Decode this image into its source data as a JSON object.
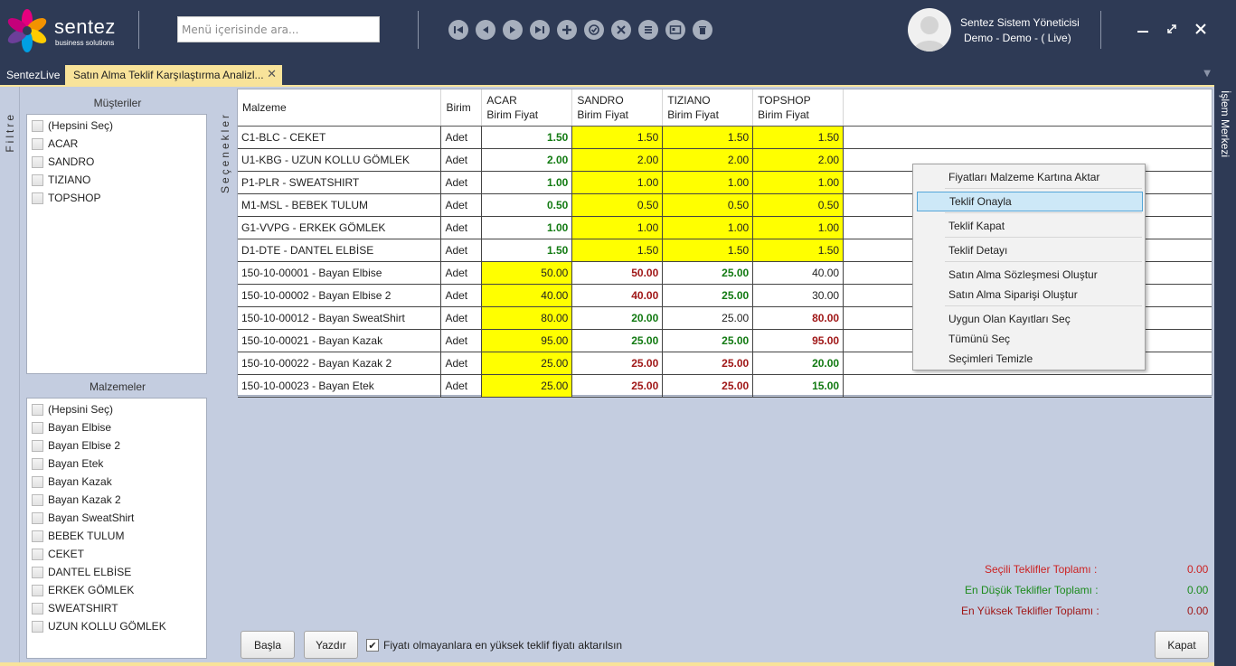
{
  "header": {
    "logo_text": "sentez",
    "logo_sub": "business solutions",
    "search_placeholder": "Menü içerisinde ara...",
    "nav_icons": [
      "first-icon",
      "prev-icon",
      "next-icon",
      "last-icon",
      "add-icon",
      "confirm-icon",
      "cancel-icon",
      "list-icon",
      "card-icon",
      "delete-icon"
    ],
    "user_name": "Sentez Sistem Yöneticisi",
    "user_context": "Demo - Demo - ( Live)"
  },
  "tabs": {
    "home": "SentezLive",
    "active": "Satın Alma Teklif Karşılaştırma Analizl...",
    "close": "✕"
  },
  "sidebar": {
    "filter_label": "Filtre",
    "options_label": "Seçenekler",
    "right_label": "İşlem Merkezi",
    "customers_title": "Müşteriler",
    "customers": [
      "(Hepsini Seç)",
      "ACAR",
      "SANDRO",
      "TIZIANO",
      "TOPSHOP"
    ],
    "materials_title": "Malzemeler",
    "materials": [
      "(Hepsini Seç)",
      "Bayan Elbise",
      "Bayan Elbise 2",
      "Bayan Etek",
      "Bayan Kazak",
      "Bayan Kazak 2",
      "Bayan SweatShirt",
      "BEBEK TULUM",
      "CEKET",
      "DANTEL ELBİSE",
      "ERKEK GÖMLEK",
      "SWEATSHIRT",
      "UZUN KOLLU GÖMLEK"
    ]
  },
  "grid": {
    "col_material": "Malzeme",
    "col_unit": "Birim",
    "suppliers": [
      {
        "name": "ACAR",
        "sub": "Birim Fiyat"
      },
      {
        "name": "SANDRO",
        "sub": "Birim Fiyat"
      },
      {
        "name": "TIZIANO",
        "sub": "Birim Fiyat"
      },
      {
        "name": "TOPSHOP",
        "sub": "Birim Fiyat"
      }
    ],
    "rows": [
      {
        "material": "C1-BLC - CEKET",
        "unit": "Adet",
        "cells": [
          {
            "v": "1.50",
            "s": "g"
          },
          {
            "v": "1.50",
            "s": "y"
          },
          {
            "v": "1.50",
            "s": "y"
          },
          {
            "v": "1.50",
            "s": "y"
          }
        ]
      },
      {
        "material": "U1-KBG - UZUN KOLLU GÖMLEK",
        "unit": "Adet",
        "cells": [
          {
            "v": "2.00",
            "s": "g"
          },
          {
            "v": "2.00",
            "s": "y"
          },
          {
            "v": "2.00",
            "s": "y"
          },
          {
            "v": "2.00",
            "s": "y"
          }
        ]
      },
      {
        "material": "P1-PLR - SWEATSHIRT",
        "unit": "Adet",
        "cells": [
          {
            "v": "1.00",
            "s": "g"
          },
          {
            "v": "1.00",
            "s": "y"
          },
          {
            "v": "1.00",
            "s": "y"
          },
          {
            "v": "1.00",
            "s": "y"
          }
        ]
      },
      {
        "material": "M1-MSL - BEBEK TULUM",
        "unit": "Adet",
        "cells": [
          {
            "v": "0.50",
            "s": "g"
          },
          {
            "v": "0.50",
            "s": "y"
          },
          {
            "v": "0.50",
            "s": "y"
          },
          {
            "v": "0.50",
            "s": "y"
          }
        ]
      },
      {
        "material": "G1-VVPG - ERKEK GÖMLEK",
        "unit": "Adet",
        "cells": [
          {
            "v": "1.00",
            "s": "g"
          },
          {
            "v": "1.00",
            "s": "y"
          },
          {
            "v": "1.00",
            "s": "y"
          },
          {
            "v": "1.00",
            "s": "y"
          }
        ]
      },
      {
        "material": "D1-DTE - DANTEL ELBİSE",
        "unit": "Adet",
        "cells": [
          {
            "v": "1.50",
            "s": "g"
          },
          {
            "v": "1.50",
            "s": "y"
          },
          {
            "v": "1.50",
            "s": "y"
          },
          {
            "v": "1.50",
            "s": "y"
          }
        ]
      },
      {
        "material": "150-10-00001 - Bayan Elbise",
        "unit": "Adet",
        "cells": [
          {
            "v": "50.00",
            "s": "y"
          },
          {
            "v": "50.00",
            "s": "r"
          },
          {
            "v": "25.00",
            "s": "g"
          },
          {
            "v": "40.00",
            "s": "n"
          }
        ]
      },
      {
        "material": "150-10-00002 - Bayan Elbise 2",
        "unit": "Adet",
        "cells": [
          {
            "v": "40.00",
            "s": "y"
          },
          {
            "v": "40.00",
            "s": "r"
          },
          {
            "v": "25.00",
            "s": "g"
          },
          {
            "v": "30.00",
            "s": "n"
          }
        ]
      },
      {
        "material": "150-10-00012 - Bayan SweatShirt",
        "unit": "Adet",
        "cells": [
          {
            "v": "80.00",
            "s": "y"
          },
          {
            "v": "20.00",
            "s": "g"
          },
          {
            "v": "25.00",
            "s": "n"
          },
          {
            "v": "80.00",
            "s": "r"
          }
        ]
      },
      {
        "material": "150-10-00021 - Bayan Kazak",
        "unit": "Adet",
        "cells": [
          {
            "v": "95.00",
            "s": "y"
          },
          {
            "v": "25.00",
            "s": "g"
          },
          {
            "v": "25.00",
            "s": "g"
          },
          {
            "v": "95.00",
            "s": "r"
          }
        ]
      },
      {
        "material": "150-10-00022 - Bayan Kazak 2",
        "unit": "Adet",
        "cells": [
          {
            "v": "25.00",
            "s": "y"
          },
          {
            "v": "25.00",
            "s": "r"
          },
          {
            "v": "25.00",
            "s": "r"
          },
          {
            "v": "20.00",
            "s": "g"
          }
        ]
      },
      {
        "material": "150-10-00023 - Bayan Etek",
        "unit": "Adet",
        "cells": [
          {
            "v": "25.00",
            "s": "y"
          },
          {
            "v": "25.00",
            "s": "r"
          },
          {
            "v": "25.00",
            "s": "r"
          },
          {
            "v": "15.00",
            "s": "g"
          }
        ]
      }
    ]
  },
  "context_menu": {
    "items": [
      "Fiyatları Malzeme Kartına Aktar",
      "Teklif Onayla",
      "Teklif Kapat",
      "Teklif Detayı",
      "Satın Alma Sözleşmesi Oluştur",
      "Satın Alma Siparişi Oluştur",
      "Uygun Olan Kayıtları Seç",
      "Tümünü Seç",
      "Seçimleri Temizle"
    ],
    "selected_index": 1
  },
  "totals": {
    "selected_label": "Seçili Teklifler Toplamı :",
    "selected_value": "0.00",
    "lowest_label": "En Düşük Teklifler Toplamı :",
    "lowest_value": "0.00",
    "highest_label": "En Yüksek Teklifler Toplamı :",
    "highest_value": "0.00"
  },
  "footer": {
    "start_button": "Başla",
    "print_button": "Yazdır",
    "checkbox_label": "Fiyatı olmayanlara en yüksek teklif fiyatı aktarılsın",
    "checkbox_checked": true,
    "close_button": "Kapat"
  },
  "colors": {
    "header_bg": "#2e3a55",
    "panel_bg": "#c4cde0",
    "tab_active": "#f8e39a",
    "highlight_yellow": "#ffff00",
    "price_green": "#127a12",
    "price_red": "#a01818",
    "total_selected": "#cc2222",
    "total_lowest": "#1c8a1c",
    "total_highest": "#a01818"
  }
}
